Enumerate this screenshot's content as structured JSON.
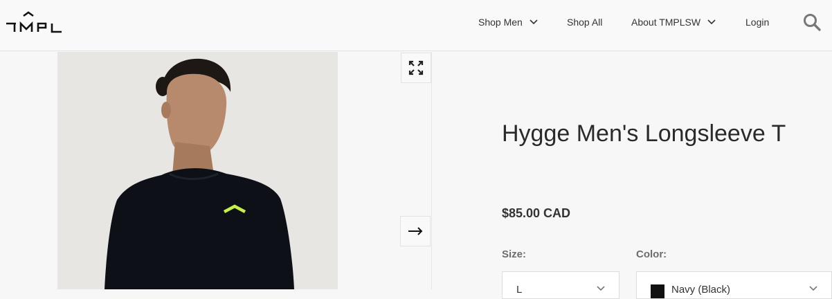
{
  "header": {
    "logo_text": "TMPL",
    "nav": [
      {
        "label": "Shop Men",
        "has_dropdown": true
      },
      {
        "label": "Shop All",
        "has_dropdown": false
      },
      {
        "label": "About TMPLSW",
        "has_dropdown": true
      },
      {
        "label": "Login",
        "has_dropdown": false
      }
    ],
    "search_icon": "search-icon"
  },
  "gallery": {
    "expand_icon": "expand-icon",
    "next_icon": "arrow-right-icon"
  },
  "product": {
    "title": "Hygge Men's Longsleeve T",
    "price": "$85.00 CAD",
    "size_label": "Size:",
    "size_value": "L",
    "color_label": "Color:",
    "color_value": "Navy (Black)",
    "color_swatch": "#111111"
  },
  "colors": {
    "accent_logo": "#c8f04a"
  }
}
